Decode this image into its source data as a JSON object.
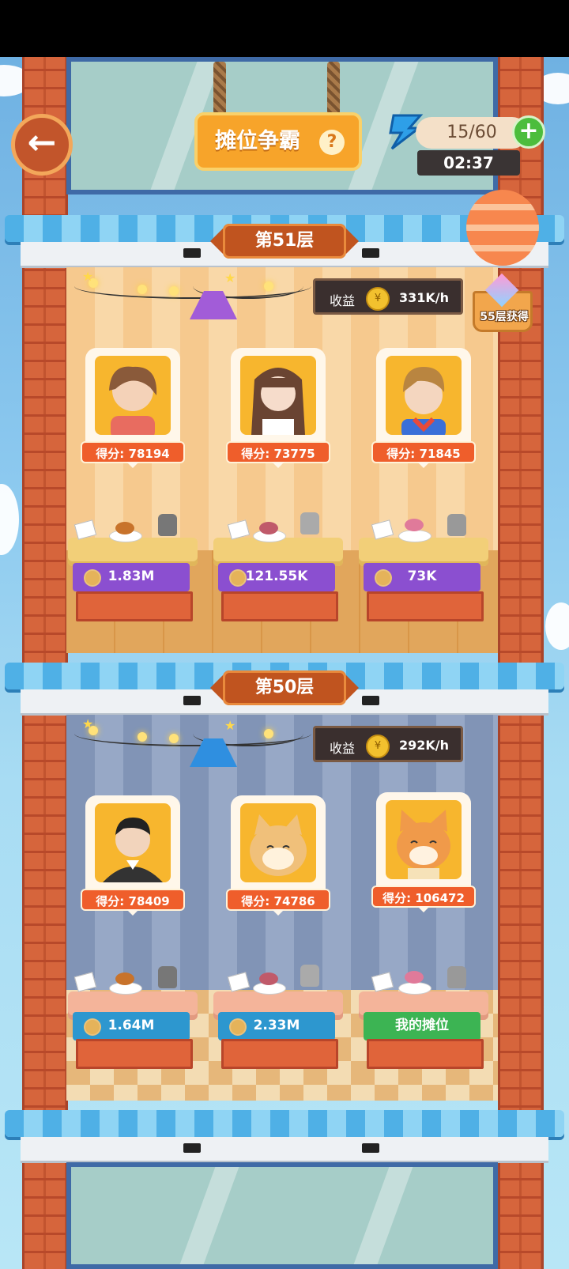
{
  "header": {
    "title": "摊位争霸",
    "help_glyph": "?",
    "back_glyph": "←",
    "energy": "15/60",
    "plus_glyph": "+",
    "timer": "02:37",
    "reward_label": "55层获得"
  },
  "floors": [
    {
      "tag": "第51层",
      "income_label": "收益",
      "income_value": "331K/h",
      "stalls": [
        {
          "score": "得分: 78194",
          "banner": "1.83M"
        },
        {
          "score": "得分: 73775",
          "banner": "121.55K"
        },
        {
          "score": "得分: 71845",
          "banner": "73K"
        }
      ]
    },
    {
      "tag": "第50层",
      "income_label": "收益",
      "income_value": "292K/h",
      "stalls": [
        {
          "score": "得分: 78409",
          "banner": "1.64M"
        },
        {
          "score": "得分: 74786",
          "banner": "2.33M"
        },
        {
          "score": "得分: 106472",
          "banner": "我的摊位"
        }
      ]
    }
  ],
  "colors": {
    "banner_51": "#8b4fd0",
    "banner_50": "#2d97cf",
    "my_stall": "#3cb453"
  }
}
